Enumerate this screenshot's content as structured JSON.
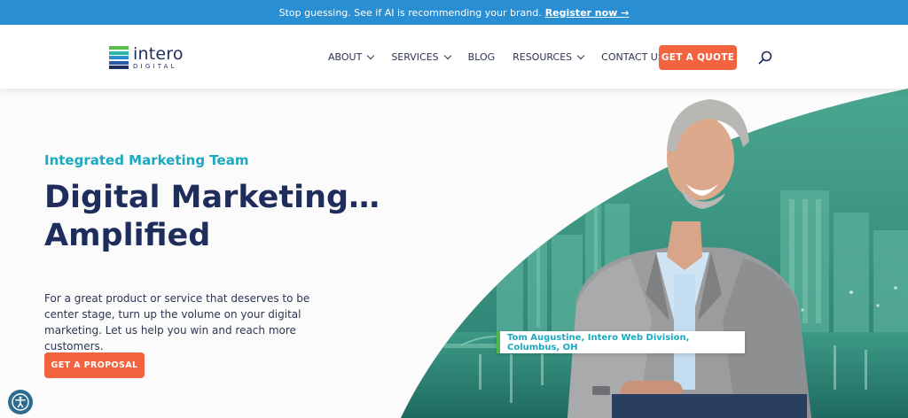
{
  "promo": {
    "text": "Stop guessing. See if AI is recommending your brand.",
    "link": "Register now →"
  },
  "logo": {
    "word": "intero",
    "sub": "DIGITAL"
  },
  "nav": {
    "items": [
      {
        "label": "ABOUT",
        "has_menu": true
      },
      {
        "label": "SERVICES",
        "has_menu": true
      },
      {
        "label": "BLOG",
        "has_menu": false
      },
      {
        "label": "RESOURCES",
        "has_menu": true
      },
      {
        "label": "CONTACT US",
        "has_menu": false
      }
    ],
    "cta": "GET A QUOTE"
  },
  "hero": {
    "eyebrow": "Integrated Marketing Team",
    "headline_line1": "Digital Marketing…",
    "headline_line2": "Amplified",
    "body": "For a great product or service that deserves to be center stage, turn up the volume on your digital marketing. Let us help you win and reach more customers.",
    "button": "GET A PROPOSAL",
    "caption": "Tom Augustine, Intero Web Division, Columbus, OH"
  },
  "colors": {
    "promo_bar": "#2a8ed3",
    "accent_orange": "#f26340",
    "teal_text": "#1aa9bf",
    "navy": "#1f2d5c",
    "hero_green": "#3a8f7e"
  }
}
